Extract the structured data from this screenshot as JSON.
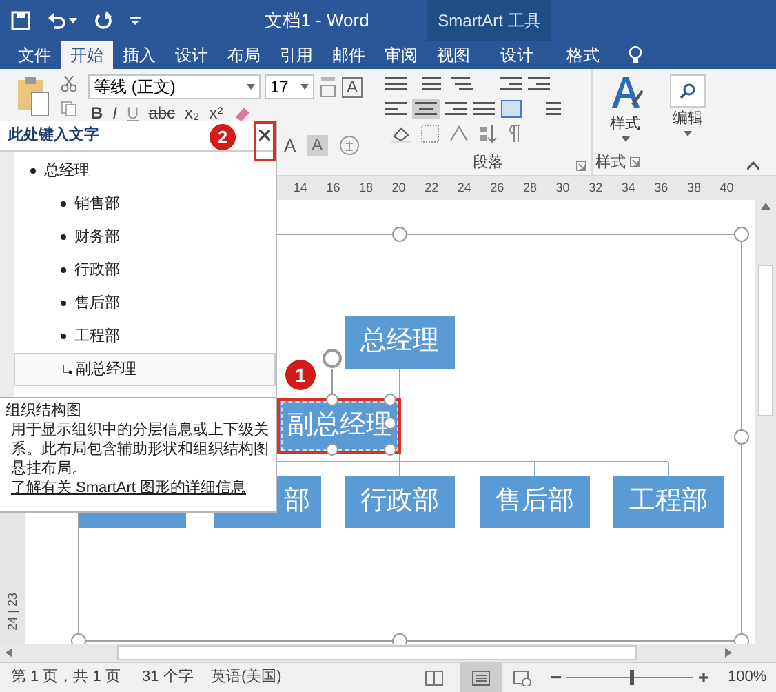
{
  "window": {
    "title": "文档1 - Word",
    "tool_context": "SmartArt 工具"
  },
  "ribbon_tabs": [
    {
      "label": "文件",
      "selected": false
    },
    {
      "label": "开始",
      "selected": true
    },
    {
      "label": "插入",
      "selected": false
    },
    {
      "label": "设计",
      "selected": false
    },
    {
      "label": "布局",
      "selected": false
    },
    {
      "label": "引用",
      "selected": false
    },
    {
      "label": "邮件",
      "selected": false
    },
    {
      "label": "审阅",
      "selected": false
    },
    {
      "label": "视图",
      "selected": false
    },
    {
      "label": "设计",
      "selected": false
    },
    {
      "label": "格式",
      "selected": false
    }
  ],
  "ribbon": {
    "font_name": "等线 (正文)",
    "font_size": "17",
    "char_border": "A",
    "font_buttons": [
      "B",
      "I",
      "U",
      "abc",
      "x₂",
      "x²"
    ],
    "grow_font": "A",
    "shading": "A",
    "styles_button": "样式",
    "edit_button": "编辑",
    "group_labels": [
      "段落",
      "样式"
    ]
  },
  "ruler": [
    "14",
    "16",
    "18",
    "20",
    "22",
    "24",
    "26",
    "28",
    "30",
    "32",
    "34",
    "36",
    "38",
    "40"
  ],
  "vertical_ruler": "24 | 23",
  "text_pane": {
    "title": "此处键入文字",
    "items": [
      {
        "text": "总经理",
        "selected": false,
        "children": [
          {
            "text": "销售部",
            "kind": "bullet",
            "selected": false
          },
          {
            "text": "财务部",
            "kind": "bullet",
            "selected": false
          },
          {
            "text": "行政部",
            "kind": "bullet",
            "selected": false
          },
          {
            "text": "售后部",
            "kind": "bullet",
            "selected": false
          },
          {
            "text": "工程部",
            "kind": "bullet",
            "selected": false
          },
          {
            "text": "副总经理",
            "kind": "assistant",
            "selected": true
          }
        ]
      }
    ],
    "layout_name": "组织结构图",
    "description": "用于显示组织中的分层信息或上下级关系。此布局包含辅助形状和组织结构图悬挂布局。",
    "link": "了解有关 SmartArt 图形的详细信息"
  },
  "diagram": {
    "nodes": [
      {
        "text": "总经理",
        "selected": false
      },
      {
        "text": "副总经理",
        "selected": true
      },
      {
        "text": "部",
        "selected": false
      },
      {
        "text": "行政部",
        "selected": false
      },
      {
        "text": "售后部",
        "selected": false
      },
      {
        "text": "工程部",
        "selected": false
      }
    ]
  },
  "callouts": [
    "1",
    "2"
  ],
  "status_bar": {
    "page": "第 1 页，共 1 页",
    "words": "31 个字",
    "language": "英语(美国)",
    "zoom": "100%",
    "zoom_slider": {
      "level": 0.5
    }
  }
}
